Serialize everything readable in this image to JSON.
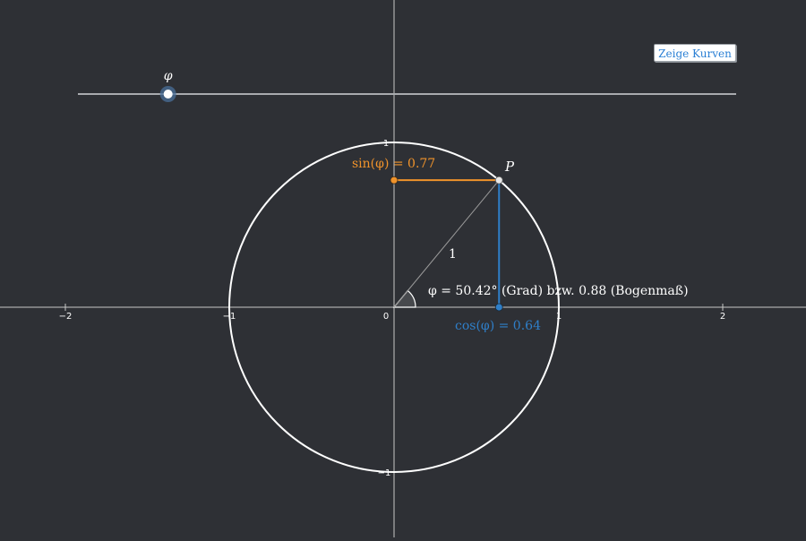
{
  "button": {
    "label": "Zeige Kurven"
  },
  "slider": {
    "label": "φ",
    "value_fraction": 0.137
  },
  "axes": {
    "x_ticks": [
      "−2",
      "−1",
      "0",
      "1",
      "2"
    ],
    "y_ticks": [
      "1",
      "−1"
    ]
  },
  "labels": {
    "point": "P",
    "radius": "1",
    "sin": "sin(φ) = 0.77",
    "cos": "cos(φ) = 0.64",
    "angle": "φ = 50.42° (Grad) bzw. 0.88 (Bogenmaß)"
  },
  "angle_deg": 50.42,
  "colors": {
    "background": "#2e3035",
    "sin": "#f0932b",
    "cos": "#2f7fc9",
    "circle": "#ffffff",
    "axis": "#c8c8c8",
    "button_text": "#2a7fd4"
  }
}
